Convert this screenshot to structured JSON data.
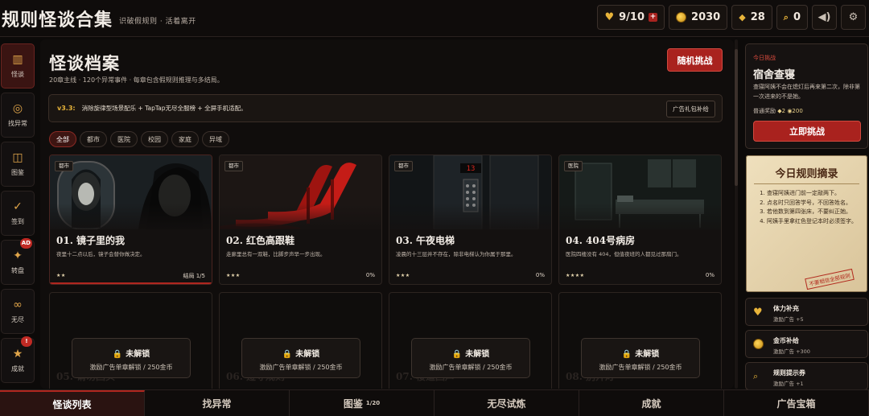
{
  "header": {
    "title": "规则怪谈合集",
    "tagline": "识破假规则 · 活着离开",
    "stats": {
      "hearts": "9/10",
      "heart_plus": "+",
      "coins": "2030",
      "gems": "28",
      "keys": "0"
    }
  },
  "leftnav": [
    {
      "label": "怪谈",
      "icon": "book-icon",
      "glyph": "▥",
      "active": true
    },
    {
      "label": "找异常",
      "icon": "target-icon",
      "glyph": "◎"
    },
    {
      "label": "图鉴",
      "icon": "album-icon",
      "glyph": "◫"
    },
    {
      "label": "签到",
      "icon": "check-icon",
      "glyph": "✓"
    },
    {
      "label": "转盘",
      "icon": "wheel-icon",
      "glyph": "✦",
      "badge": "AD"
    },
    {
      "label": "无尽",
      "icon": "infinity-icon",
      "glyph": "∞"
    },
    {
      "label": "成就",
      "icon": "star-icon",
      "glyph": "★",
      "badge": "!"
    }
  ],
  "main": {
    "title": "怪谈档案",
    "subtitle": "20章主线 · 120个异常事件 · 每章包含假规则推理与多结局。",
    "random_button": "随机挑战",
    "notice": {
      "version": "v3.3:",
      "text": "消除旋律型场景配乐 + TapTap无尽全服榜 + 全屏手机适配。",
      "button": "广告礼包补给"
    },
    "filters": [
      "全部",
      "都市",
      "医院",
      "校园",
      "家庭",
      "异域"
    ],
    "cards": [
      {
        "tag": "都市",
        "title": "01. 镜子里的我",
        "desc": "夜里十二点以后，镜子会替你做决定。",
        "stars": "★★",
        "progress": "结局 1/5"
      },
      {
        "tag": "都市",
        "title": "02. 红色高跟鞋",
        "desc": "走廊里总有一双鞋，比脚步声早一步出现。",
        "stars": "★★★",
        "progress": "0%"
      },
      {
        "tag": "都市",
        "title": "03. 午夜电梯",
        "desc": "凌晨的十三层并不存在，除非电梯认为你属于那里。",
        "stars": "★★★",
        "progress": "0%"
      },
      {
        "tag": "医院",
        "title": "04. 404号病房",
        "desc": "医院四楼没有 404，但值夜班的人都见过那扇门。",
        "stars": "★★★★",
        "progress": "0%"
      }
    ],
    "locked_cards": [
      {
        "ghost": "05. 请勿回头",
        "title": "未解锁",
        "sub": "激励广告单章解锁 / 250金币"
      },
      {
        "ghost": "06. 遵守规则",
        "title": "未解锁",
        "sub": "激励广告单章解锁 / 250金币"
      },
      {
        "ghost": "07. 楼道回声",
        "title": "未解锁",
        "sub": "激励广告单章解锁 / 250金币"
      },
      {
        "ghost": "08. 别开灯",
        "title": "未解锁",
        "sub": "激励广告单章解锁 / 250金币"
      }
    ]
  },
  "right": {
    "daily": {
      "label": "今日挑战",
      "title": "宿舍查寝",
      "desc": "查寝阿姨不会在熄灯后再来第二次，除非第一次进来的不是她。",
      "reward_label": "普通奖励",
      "reward_gems": "◆2",
      "reward_coins": "200",
      "button": "立即挑战"
    },
    "rules": {
      "title": "今日规则摘录",
      "items": [
        "查寝阿姨进门前一定敲两下。",
        "点名时只回答学号，不回答姓名。",
        "若他数到第四张床，不要纠正她。",
        "阿姨手里拿红色登记本时必须签字。"
      ],
      "stamp": "不要相信全部规则"
    },
    "bonuses": [
      {
        "title": "体力补充",
        "sub": "激励广告 +5",
        "icon": "heart-icon"
      },
      {
        "title": "金币补给",
        "sub": "激励广告 +300",
        "icon": "coin-icon"
      },
      {
        "title": "规则提示券",
        "sub": "激励广告 +1",
        "icon": "key-icon"
      }
    ]
  },
  "tabs": [
    {
      "label": "怪谈列表",
      "active": true
    },
    {
      "label": "找异常"
    },
    {
      "label": "图鉴",
      "count": "1/20"
    },
    {
      "label": "无尽试炼"
    },
    {
      "label": "成就"
    },
    {
      "label": "广告宝箱"
    }
  ],
  "colors": {
    "accent": "#a9221e",
    "gold": "#e8b43a",
    "bg": "#0c0a09"
  }
}
